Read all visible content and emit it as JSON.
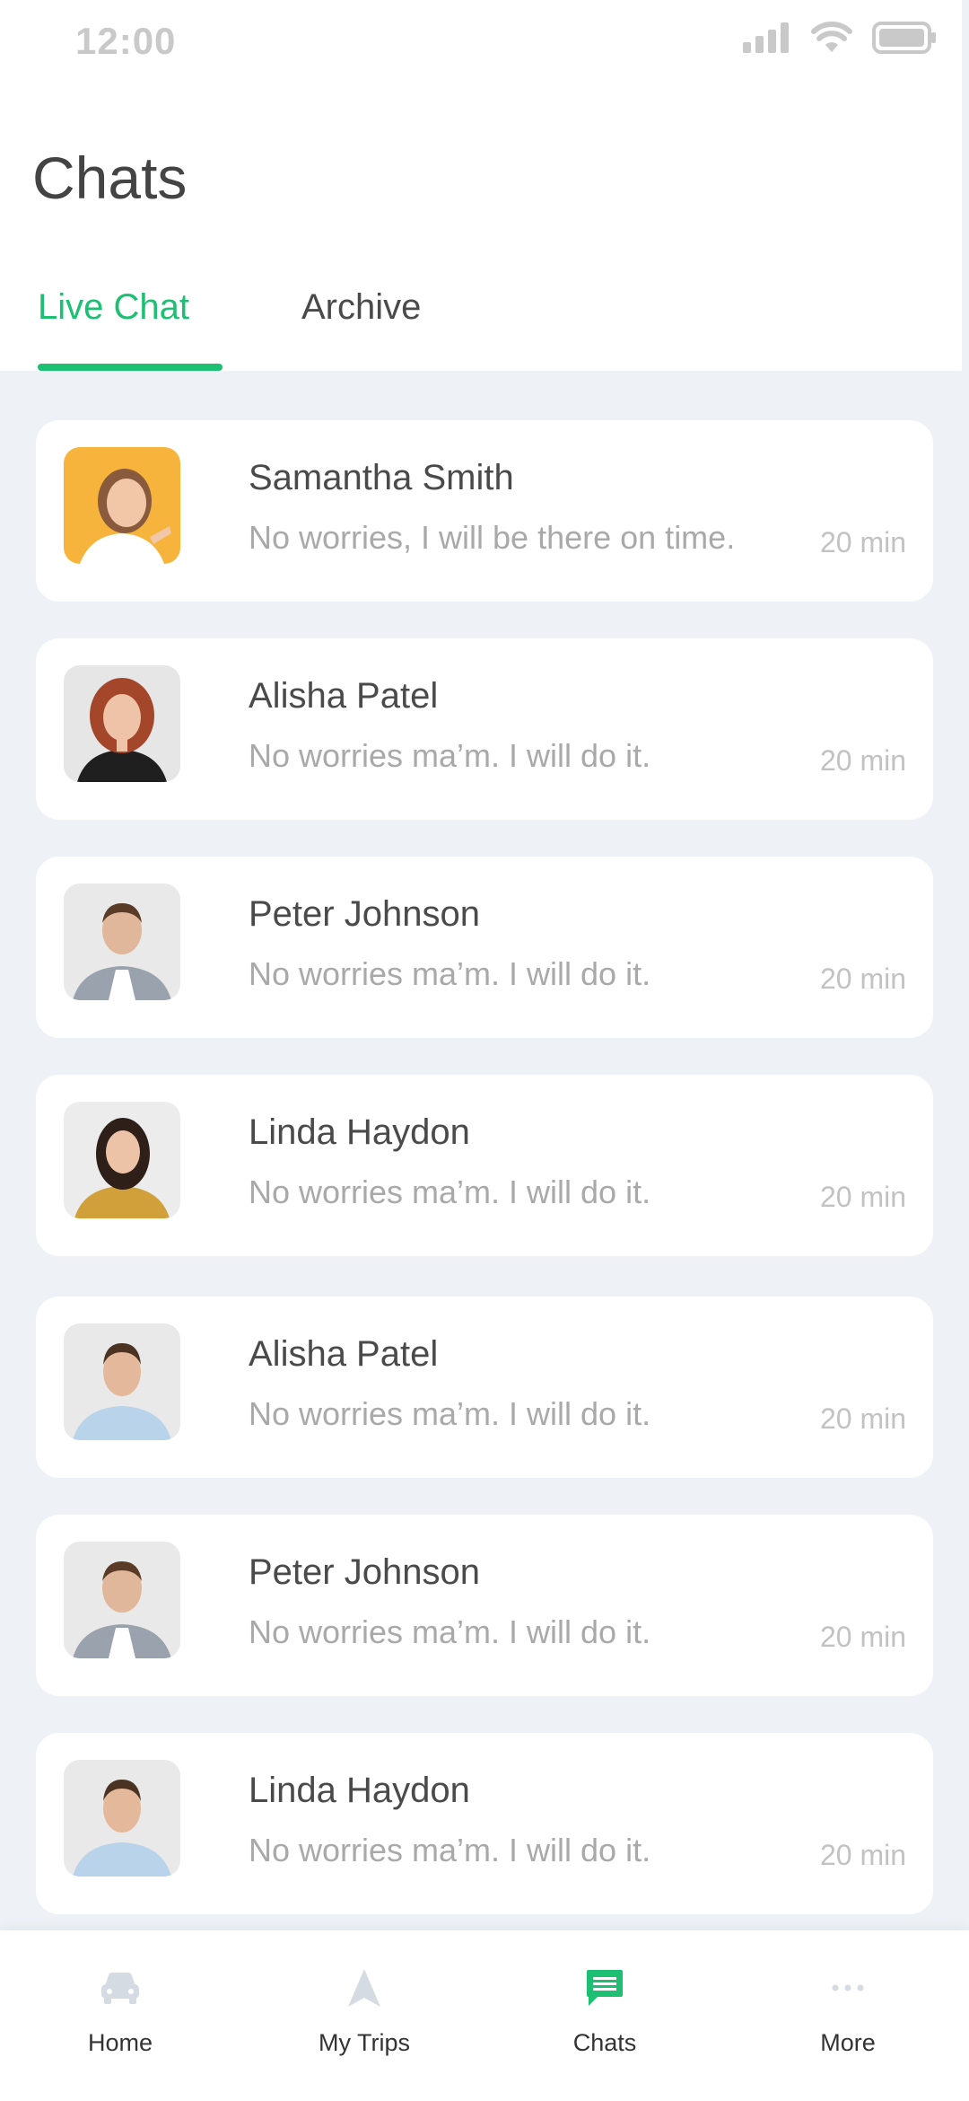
{
  "status_bar": {
    "time": "12:00"
  },
  "header": {
    "title": "Chats"
  },
  "tabs": [
    {
      "label": "Live Chat",
      "active": true
    },
    {
      "label": "Archive",
      "active": false
    }
  ],
  "chats": [
    {
      "name": "Samantha Smith",
      "message": "No worries, I will be there on time.",
      "time": "20 min"
    },
    {
      "name": "Alisha Patel",
      "message": "No worries ma’m. I will do it.",
      "time": "20 min"
    },
    {
      "name": "Peter Johnson",
      "message": "No worries ma’m. I will do it.",
      "time": "20 min"
    },
    {
      "name": "Linda Haydon",
      "message": "No worries ma’m. I will do it.",
      "time": "20 min"
    },
    {
      "name": "Alisha Patel",
      "message": "No worries ma’m. I will do it.",
      "time": "20 min"
    },
    {
      "name": "Peter Johnson",
      "message": "No worries ma’m. I will do it.",
      "time": "20 min"
    },
    {
      "name": "Linda Haydon",
      "message": "No worries ma’m. I will do it.",
      "time": "20 min"
    }
  ],
  "bottom_nav": [
    {
      "label": "Home",
      "icon": "car-icon",
      "active": false
    },
    {
      "label": "My Trips",
      "icon": "navigation-arrow-icon",
      "active": false
    },
    {
      "label": "Chats",
      "icon": "chat-bubble-icon",
      "active": true
    },
    {
      "label": "More",
      "icon": "more-dots-icon",
      "active": false
    }
  ],
  "colors": {
    "accent": "#1dbf73",
    "background": "#eef2f7",
    "card": "#ffffff"
  }
}
